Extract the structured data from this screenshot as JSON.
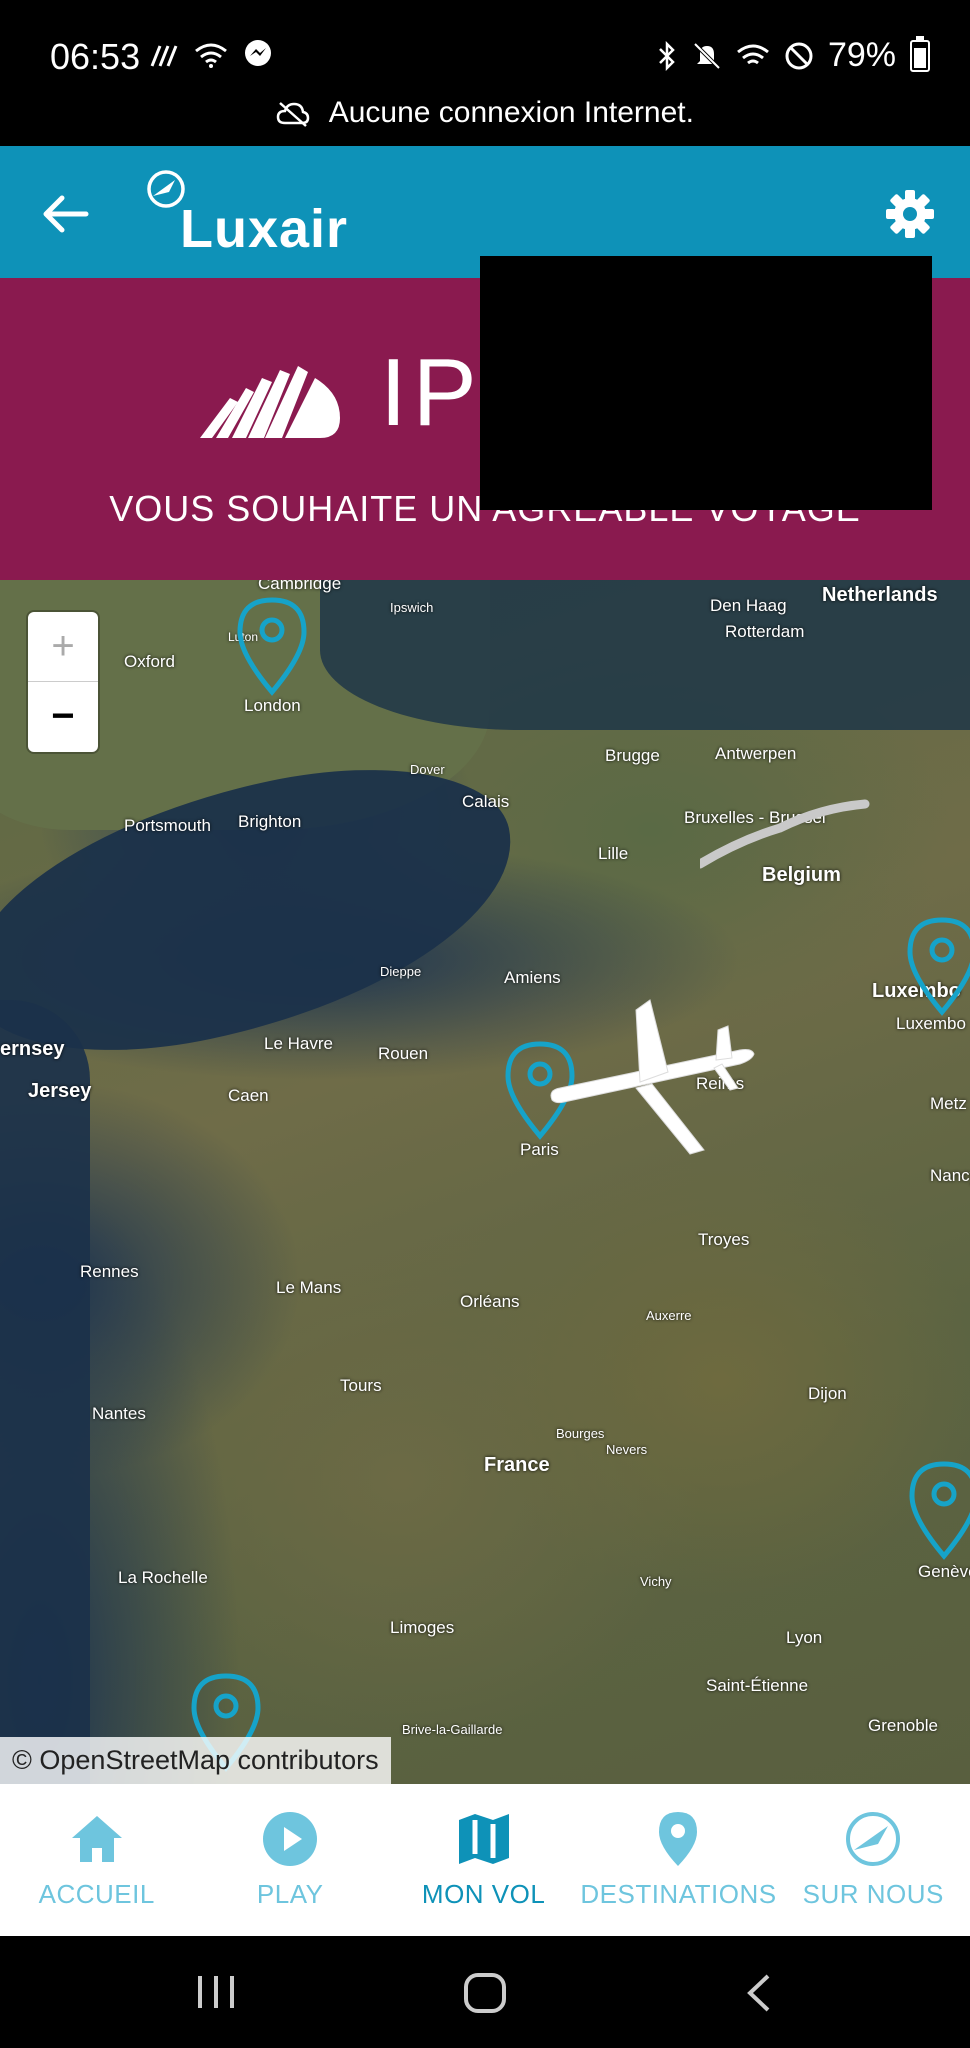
{
  "status_bar": {
    "time": "06:53",
    "battery": "79%"
  },
  "connection_banner": {
    "message": "Aucune connexion Internet."
  },
  "app_bar": {
    "brand": "Luxair"
  },
  "promo_banner": {
    "big_text": "IP",
    "tagline": "VOUS SOUHAITE UN AGRÉABLE VOYAGE"
  },
  "map": {
    "zoom_in": "+",
    "zoom_out": "−",
    "attribution": "© OpenStreetMap contributors",
    "labels": {
      "netherlands": "Netherlands",
      "den_haag": "Den Haag",
      "rotterdam": "Rotterdam",
      "cambridge": "Cambridge",
      "ipswich": "Ipswich",
      "oxford": "Oxford",
      "london": "London",
      "luton": "Luton",
      "dover": "Dover",
      "calais": "Calais",
      "brugge": "Brugge",
      "antwerpen": "Antwerpen",
      "portsmouth": "Portsmouth",
      "brighton": "Brighton",
      "bruxelles": "Bruxelles - Brussel",
      "lille": "Lille",
      "belgium": "Belgium",
      "dieppe": "Dieppe",
      "amiens": "Amiens",
      "luxembourg_bold": "Luxembo",
      "luxembourg": "Luxembo",
      "guernsey": "ernsey",
      "jersey": "Jersey",
      "le_havre": "Le Havre",
      "rouen": "Rouen",
      "caen": "Caen",
      "reims": "Reims",
      "paris": "Paris",
      "metz": "Metz",
      "nancy": "Nancy",
      "troyes": "Troyes",
      "rennes": "Rennes",
      "le_mans": "Le Mans",
      "orleans": "Orléans",
      "auxerre": "Auxerre",
      "tours": "Tours",
      "dijon": "Dijon",
      "nantes": "Nantes",
      "france": "France",
      "bourges": "Bourges",
      "nevers": "Nevers",
      "la_rochelle": "La Rochelle",
      "vichy": "Vichy",
      "geneve": "Genève",
      "limoges": "Limoges",
      "lyon": "Lyon",
      "saint_etienne": "Saint-Étienne",
      "brive": "Brive-la-Gaillarde",
      "grenoble": "Grenoble"
    }
  },
  "bottom_nav": {
    "items": [
      {
        "label": "ACCUEIL",
        "icon": "home-icon"
      },
      {
        "label": "PLAY",
        "icon": "play-icon"
      },
      {
        "label": "MON VOL",
        "icon": "map-icon",
        "active": true
      },
      {
        "label": "DESTINATIONS",
        "icon": "location-pin-icon"
      },
      {
        "label": "SUR NOUS",
        "icon": "luxair-emblem-icon"
      }
    ]
  },
  "colors": {
    "brand_blue": "#0e92b8",
    "banner_plum": "#8a1a4f",
    "nav_inactive": "#6ec5de"
  }
}
